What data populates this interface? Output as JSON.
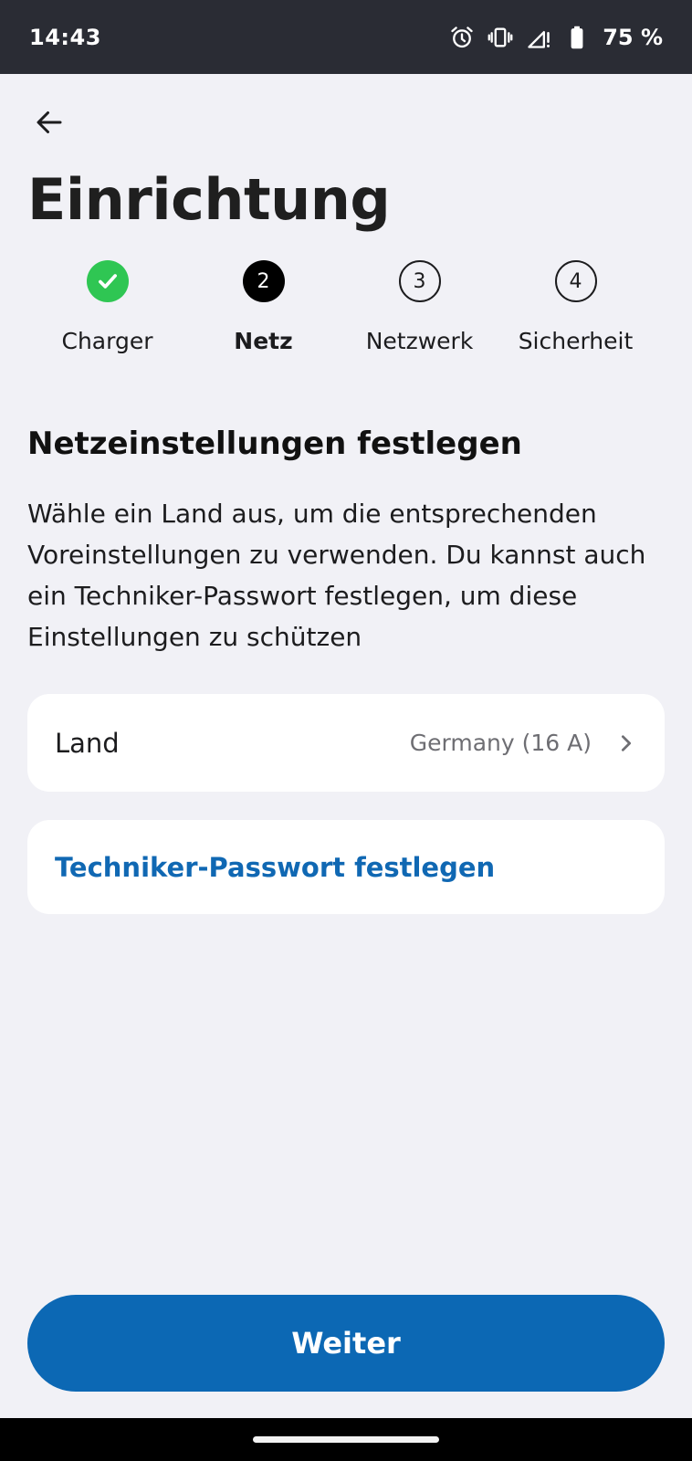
{
  "status_bar": {
    "time": "14:43",
    "battery_percent": "75 %",
    "icons": [
      "alarm-icon",
      "vibrate-icon",
      "signal-icon",
      "battery-icon"
    ]
  },
  "header": {
    "title": "Einrichtung"
  },
  "stepper": {
    "steps": [
      {
        "label": "Charger",
        "state": "done",
        "number": ""
      },
      {
        "label": "Netz",
        "state": "active",
        "number": "2"
      },
      {
        "label": "Netzwerk",
        "state": "pending",
        "number": "3"
      },
      {
        "label": "Sicherheit",
        "state": "pending",
        "number": "4"
      }
    ]
  },
  "section": {
    "heading": "Netzeinstellungen festlegen",
    "description": "Wähle ein Land aus, um die entsprechenden Voreinstellungen zu verwenden. Du kannst auch ein Techniker-Passwort festlegen, um diese Einstellungen zu schützen"
  },
  "country_row": {
    "label": "Land",
    "value": "Germany (16 A)"
  },
  "password_row": {
    "label": "Techniker-Passwort festlegen"
  },
  "footer": {
    "continue_label": "Weiter"
  },
  "colors": {
    "accent": "#0c68b4",
    "link": "#1068b3",
    "success": "#2fc653",
    "background": "#f1f1f6",
    "status_bar": "#2a2c34"
  }
}
